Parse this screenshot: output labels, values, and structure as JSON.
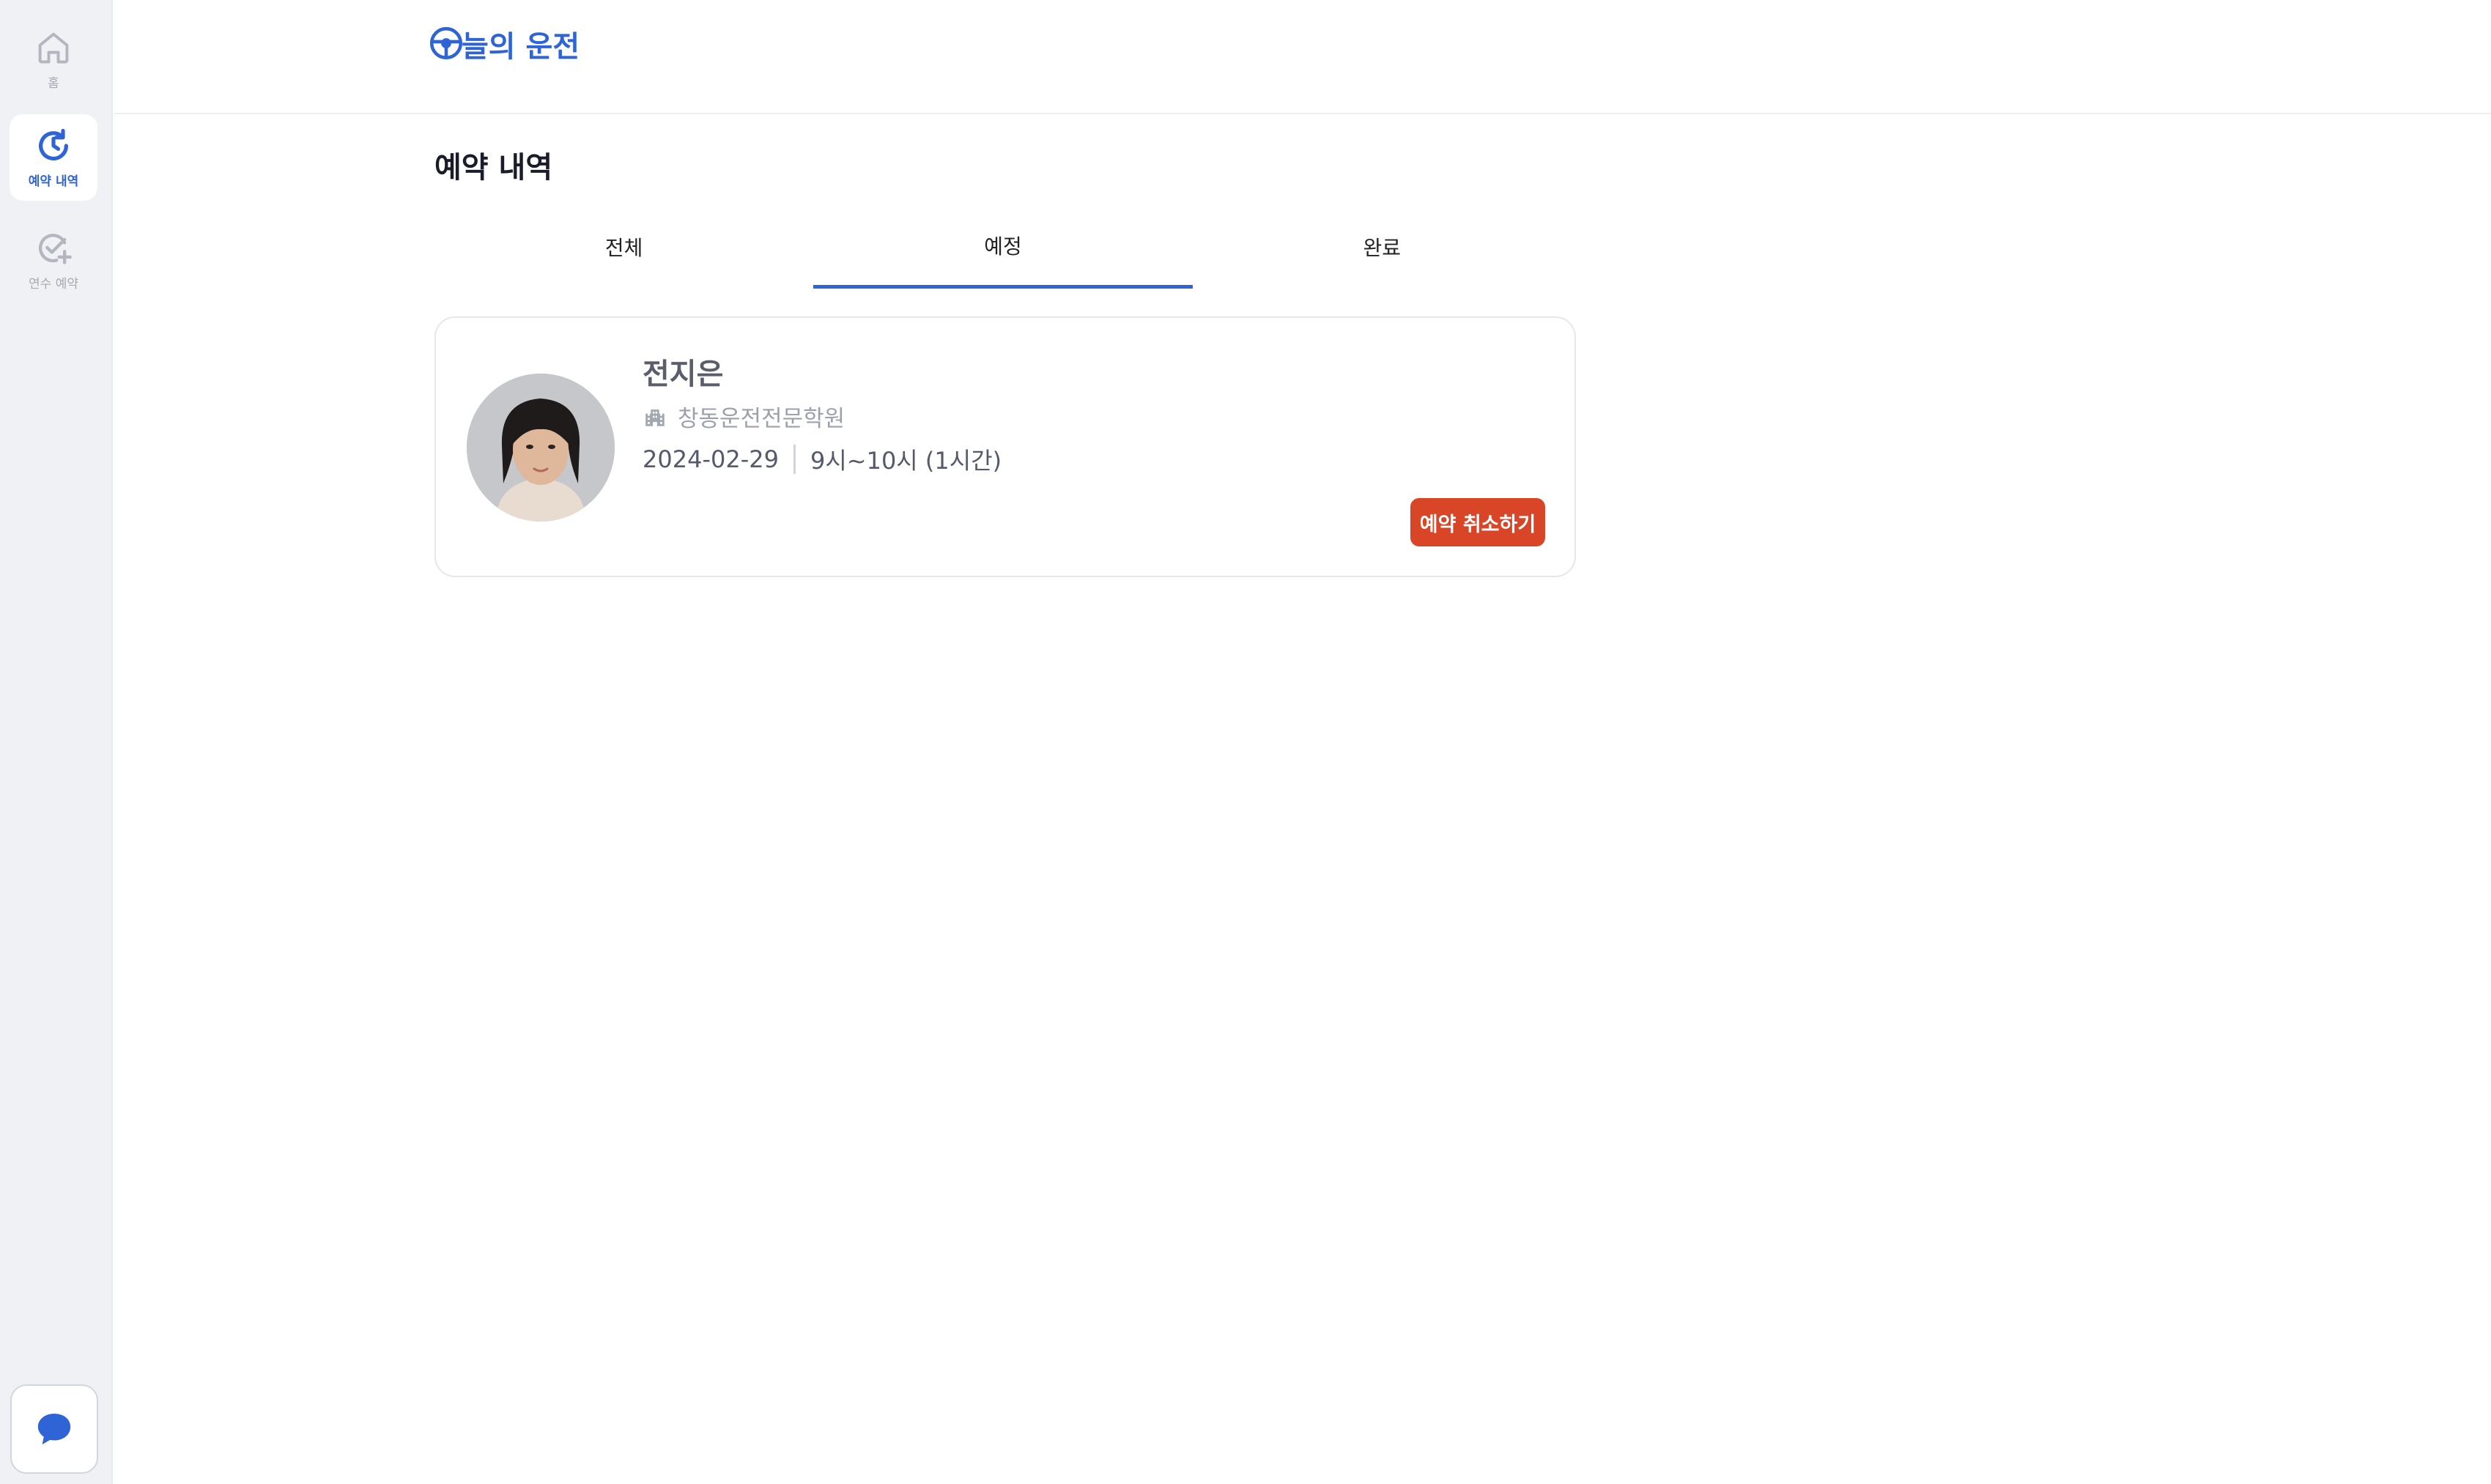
{
  "sidebar": {
    "items": [
      {
        "label": "홈",
        "icon": "home-icon"
      },
      {
        "label": "예약 내역",
        "icon": "history-icon"
      },
      {
        "label": "연수 예약",
        "icon": "check-plus-icon"
      }
    ],
    "chat_icon": "chat-bubble-icon"
  },
  "header": {
    "logo_text": "늘의 운전",
    "logo_icon": "steering-wheel-icon"
  },
  "page": {
    "title": "예약 내역"
  },
  "tabs": [
    {
      "label": "전체"
    },
    {
      "label": "예정"
    },
    {
      "label": "완료"
    }
  ],
  "reservation": {
    "instructor_name": "전지은",
    "academy": "창동운전전문학원",
    "date": "2024-02-29",
    "time": "9시~10시 (1시간)",
    "cancel_label": "예약 취소하기"
  },
  "colors": {
    "accent": "#2f64d6",
    "danger": "#d84527",
    "sidebar_bg": "#f0f1f5"
  }
}
